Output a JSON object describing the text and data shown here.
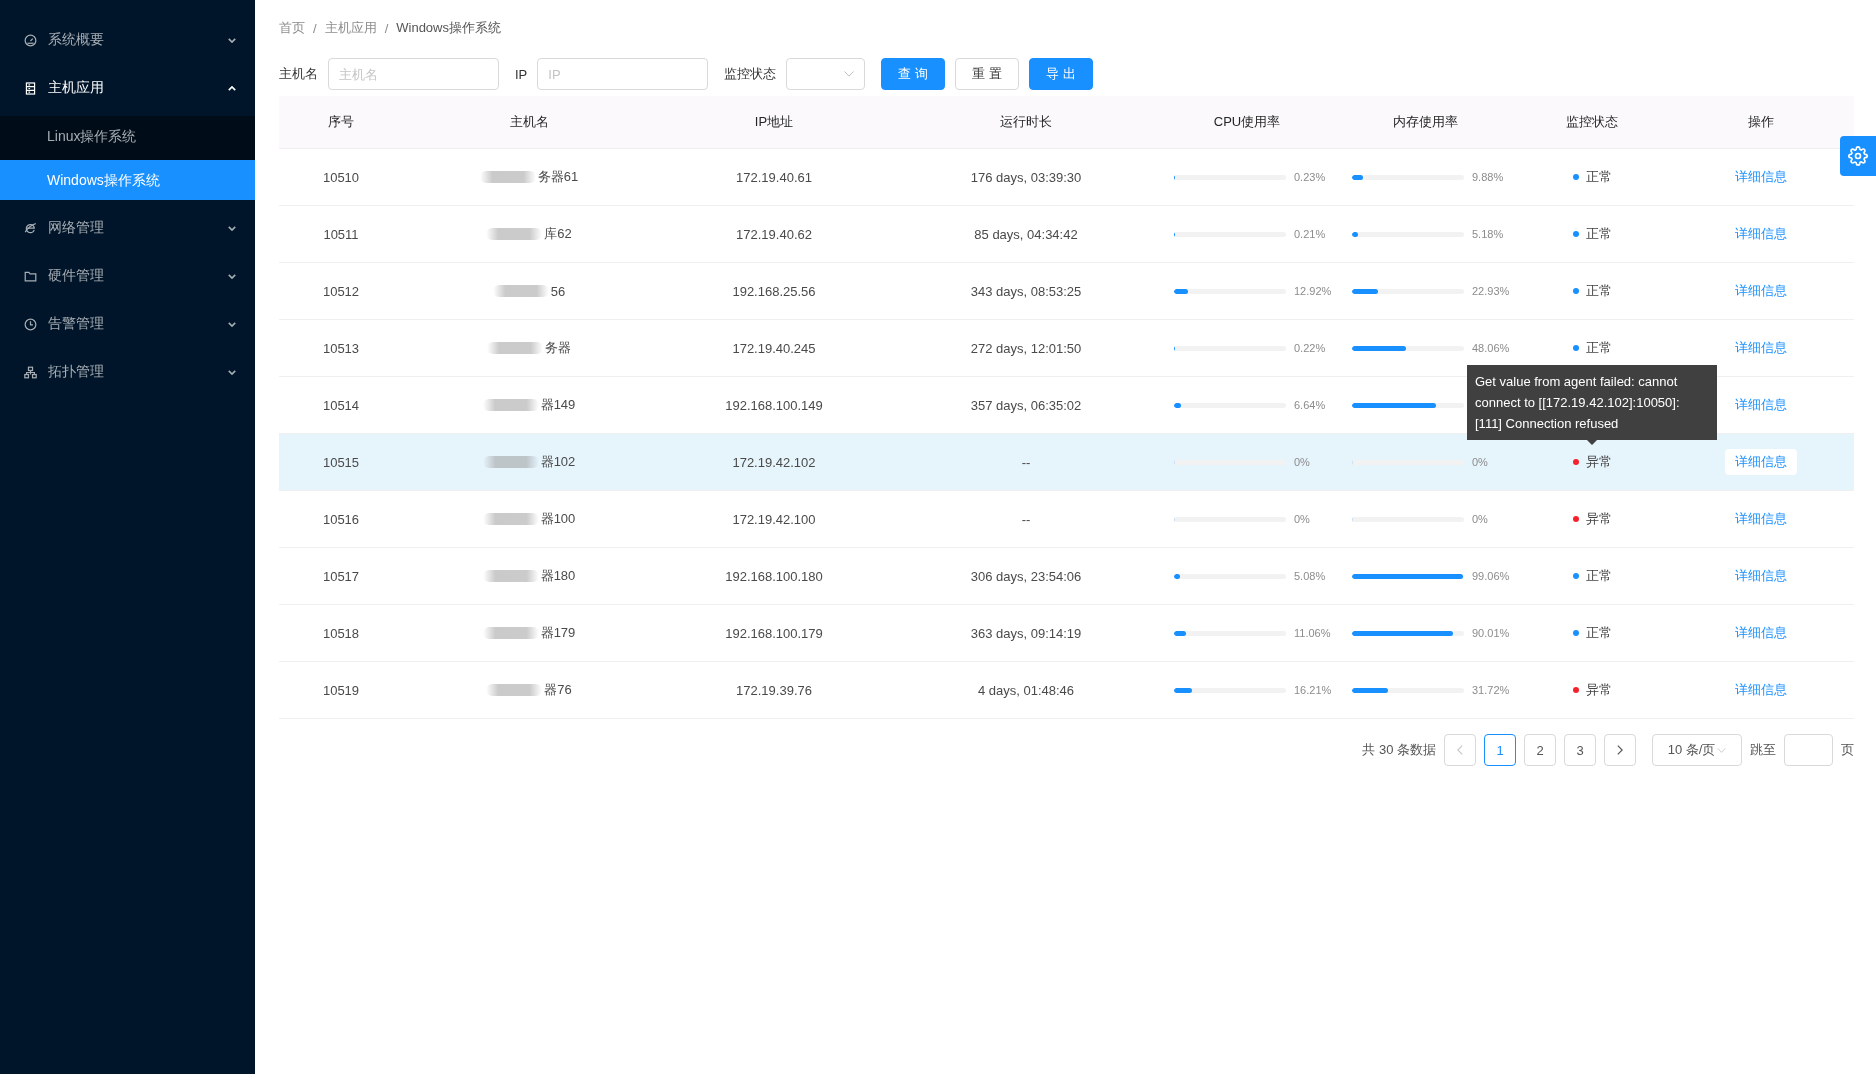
{
  "sidebar": {
    "items": [
      {
        "label": "系统概要",
        "expanded": false
      },
      {
        "label": "主机应用",
        "expanded": true,
        "children": [
          {
            "label": "Linux操作系统",
            "selected": false
          },
          {
            "label": "Windows操作系统",
            "selected": true
          }
        ]
      },
      {
        "label": "网络管理",
        "expanded": false
      },
      {
        "label": "硬件管理",
        "expanded": false
      },
      {
        "label": "告警管理",
        "expanded": false
      },
      {
        "label": "拓扑管理",
        "expanded": false
      }
    ]
  },
  "breadcrumb": [
    {
      "label": "首页",
      "separator": "/"
    },
    {
      "label": "主机应用",
      "separator": "/"
    },
    {
      "label": "Windows操作系统"
    }
  ],
  "filters": {
    "fields": [
      {
        "label": "主机名",
        "placeholder": "主机名"
      },
      {
        "label": "IP",
        "placeholder": "IP"
      }
    ],
    "select": {
      "label": "监控状态"
    },
    "buttons": [
      {
        "label": "查 询",
        "kind": "primary"
      },
      {
        "label": "重 置",
        "kind": "default"
      },
      {
        "label": "导 出",
        "kind": "primary"
      }
    ]
  },
  "table": {
    "columns": [
      "序号",
      "主机名",
      "IP地址",
      "运行时长",
      "CPU使用率",
      "内存使用率",
      "监控状态",
      "操作"
    ],
    "rows": [
      {
        "id": "10510",
        "host": "务器61",
        "ip": "172.19.40.61",
        "uptime": "176 days, 03:39:30",
        "cpu": {
          "level": 0.0023,
          "reading": "0.23%"
        },
        "memory": {
          "level": 0.0988,
          "reading": "9.88%"
        },
        "status": {
          "text": "正常",
          "color": "#1890ff"
        },
        "action": "详细信息",
        "highlighted": false
      },
      {
        "id": "10511",
        "host": "库62",
        "ip": "172.19.40.62",
        "uptime": "85 days, 04:34:42",
        "cpu": {
          "level": 0.0021,
          "reading": "0.21%"
        },
        "memory": {
          "level": 0.0518,
          "reading": "5.18%"
        },
        "status": {
          "text": "正常",
          "color": "#1890ff"
        },
        "action": "详细信息",
        "highlighted": false
      },
      {
        "id": "10512",
        "host": "56",
        "ip": "192.168.25.56",
        "uptime": "343 days, 08:53:25",
        "cpu": {
          "level": 0.1292,
          "reading": "12.92%"
        },
        "memory": {
          "level": 0.2293,
          "reading": "22.93%"
        },
        "status": {
          "text": "正常",
          "color": "#1890ff"
        },
        "action": "详细信息",
        "highlighted": false
      },
      {
        "id": "10513",
        "host": "务器",
        "ip": "172.19.40.245",
        "uptime": "272 days, 12:01:50",
        "cpu": {
          "level": 0.0022,
          "reading": "0.22%"
        },
        "memory": {
          "level": 0.4806,
          "reading": "48.06%"
        },
        "status": {
          "text": "正常",
          "color": "#1890ff"
        },
        "action": "详细信息",
        "highlighted": false
      },
      {
        "id": "10514",
        "host": "器149",
        "ip": "192.168.100.149",
        "uptime": "357 days, 06:35:02",
        "cpu": {
          "level": 0.0664,
          "reading": "6.64%"
        },
        "memory": {
          "level": 0.7465
        },
        "action": "详细信息",
        "highlighted": false
      },
      {
        "id": "10515",
        "host": "器102",
        "ip": "172.19.42.102",
        "uptime": "--",
        "cpu": {
          "level": 0,
          "reading": "0%"
        },
        "memory": {
          "level": 0,
          "reading": "0%"
        },
        "status": {
          "text": "异常",
          "color": "#f5222d",
          "tooltip": "Get value from agent failed: cannot connect to [[172.19.42.102]:10050]: [111] Connection refused"
        },
        "action": "详细信息",
        "highlighted": true
      },
      {
        "id": "10516",
        "host": "器100",
        "ip": "172.19.42.100",
        "uptime": "--",
        "cpu": {
          "level": 0,
          "reading": "0%"
        },
        "memory": {
          "level": 0,
          "reading": "0%"
        },
        "status": {
          "text": "异常",
          "color": "#f5222d"
        },
        "action": "详细信息",
        "highlighted": false
      },
      {
        "id": "10517",
        "host": "器180",
        "ip": "192.168.100.180",
        "uptime": "306 days, 23:54:06",
        "cpu": {
          "level": 0.0508,
          "reading": "5.08%"
        },
        "memory": {
          "level": 0.9906,
          "reading": "99.06%"
        },
        "status": {
          "text": "正常",
          "color": "#1890ff"
        },
        "action": "详细信息",
        "highlighted": false
      },
      {
        "id": "10518",
        "host": "器179",
        "ip": "192.168.100.179",
        "uptime": "363 days, 09:14:19",
        "cpu": {
          "level": 0.1106,
          "reading": "11.06%"
        },
        "memory": {
          "level": 0.9001,
          "reading": "90.01%"
        },
        "status": {
          "text": "正常",
          "color": "#1890ff"
        },
        "action": "详细信息",
        "highlighted": false
      },
      {
        "id": "10519",
        "host": "器76",
        "ip": "172.19.39.76",
        "uptime": "4 days, 01:48:46",
        "cpu": {
          "level": 0.1621,
          "reading": "16.21%"
        },
        "memory": {
          "level": 0.3172,
          "reading": "31.72%"
        },
        "status": {
          "text": "异常",
          "color": "#f5222d"
        },
        "action": "详细信息",
        "highlighted": false
      }
    ]
  },
  "pagination": {
    "total": "共 30 条数据",
    "prev": {
      "disabled": true
    },
    "pages": [
      {
        "label": "1",
        "selected": true
      },
      {
        "label": "2",
        "selected": false
      },
      {
        "label": "3",
        "selected": false
      }
    ],
    "next": {
      "disabled": false
    },
    "page_size": "10 条/页",
    "jump_label": "跳至",
    "jump_suffix": "页"
  }
}
